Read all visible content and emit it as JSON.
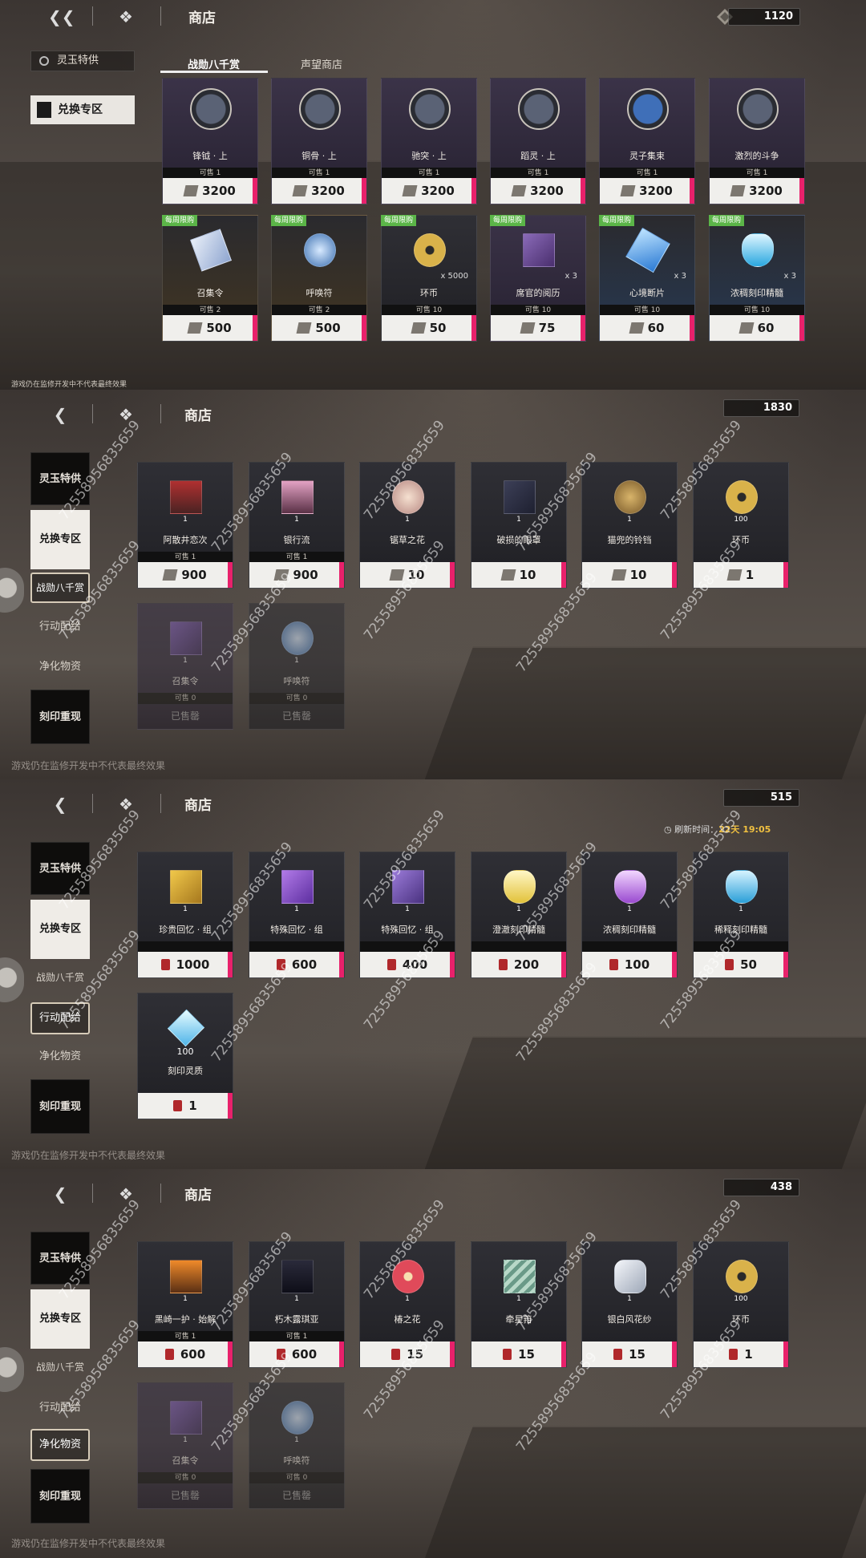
{
  "watermark": "72558956835659",
  "panel1": {
    "title": "商店",
    "currency": "1120",
    "side_items": [
      "灵玉特供",
      "兑换专区"
    ],
    "tabs": [
      "战勋八千赏",
      "声望商店"
    ],
    "footnote": "游戏仍在监修开发中不代表最终效果",
    "row1": [
      {
        "name": "锋钺 · 上",
        "limit": "可售 1",
        "price": "3200"
      },
      {
        "name": "铜骨 · 上",
        "limit": "可售 1",
        "price": "3200"
      },
      {
        "name": "驰突 · 上",
        "limit": "可售 1",
        "price": "3200"
      },
      {
        "name": "蹈灵 · 上",
        "limit": "可售 1",
        "price": "3200"
      },
      {
        "name": "灵子集束",
        "limit": "可售 1",
        "price": "3200"
      },
      {
        "name": "激烈的斗争",
        "limit": "可售 1",
        "price": "3200"
      }
    ],
    "row2": [
      {
        "badge": "每周限购",
        "name": "召集令",
        "limit": "可售 2",
        "price": "500",
        "x": ""
      },
      {
        "badge": "每周限购",
        "name": "呼唤符",
        "limit": "可售 2",
        "price": "500",
        "x": ""
      },
      {
        "badge": "每周限购",
        "name": "环币",
        "limit": "可售 10",
        "price": "50",
        "x": "x 5000"
      },
      {
        "badge": "每周限购",
        "name": "席官的阅历",
        "limit": "可售 10",
        "price": "75",
        "x": "x 3"
      },
      {
        "badge": "每周限购",
        "name": "心境断片",
        "limit": "可售 10",
        "price": "60",
        "x": "x 3"
      },
      {
        "badge": "每周限购",
        "name": "浓稠刻印精髓",
        "limit": "可售 10",
        "price": "60",
        "x": "x 3"
      }
    ]
  },
  "panel2": {
    "title": "商店",
    "currency": "1830",
    "side": [
      "灵玉特供",
      "兑换专区",
      "战勋八千赏",
      "行动配给",
      "净化物资",
      "刻印重现"
    ],
    "footnote": "游戏仍在监修开发中不代表最终效果",
    "row1": [
      {
        "name": "阿散井恋次",
        "qty": "1",
        "limit": "可售 1",
        "price": "900"
      },
      {
        "name": "银行流",
        "qty": "1",
        "limit": "可售 1",
        "price": "900"
      },
      {
        "name": "锯草之花",
        "qty": "1",
        "limit": "",
        "price": "10"
      },
      {
        "name": "破损的眼罩",
        "qty": "1",
        "limit": "",
        "price": "10"
      },
      {
        "name": "猫兜的铃铛",
        "qty": "1",
        "limit": "",
        "price": "10"
      },
      {
        "name": "环币",
        "qty": "100",
        "limit": "",
        "price": "1"
      }
    ],
    "row2": [
      {
        "name": "召集令",
        "qty": "1",
        "limit": "可售 0",
        "price": "已售罄"
      },
      {
        "name": "呼唤符",
        "qty": "1",
        "limit": "可售 0",
        "price": "已售罄"
      }
    ]
  },
  "panel3": {
    "title": "商店",
    "currency": "515",
    "timer_label": "刷新时间：",
    "timer_value": "22天 19:05",
    "footnote": "游戏仍在监修开发中不代表最终效果",
    "side": [
      "灵玉特供",
      "兑换专区",
      "战勋八千赏",
      "行动配给",
      "净化物资",
      "刻印重现"
    ],
    "row1": [
      {
        "name": "珍贵回忆 · 组",
        "qty": "1",
        "price": "1000"
      },
      {
        "name": "特殊回忆 · 组",
        "qty": "1",
        "price": "600"
      },
      {
        "name": "特殊回忆 · 组",
        "qty": "1",
        "price": "400"
      },
      {
        "name": "澄澈刻印精髓",
        "qty": "1",
        "price": "200"
      },
      {
        "name": "浓稠刻印精髓",
        "qty": "1",
        "price": "100"
      },
      {
        "name": "稀释刻印精髓",
        "qty": "1",
        "price": "50"
      }
    ],
    "row2": [
      {
        "name": "刻印灵质",
        "qty": "100",
        "price": "1"
      }
    ]
  },
  "panel4": {
    "title": "商店",
    "currency": "438",
    "footnote": "游戏仍在监修开发中不代表最终效果",
    "side": [
      "灵玉特供",
      "兑换专区",
      "战勋八千赏",
      "行动配给",
      "净化物资",
      "刻印重现"
    ],
    "row1": [
      {
        "name": "黑崎一护 · 始解",
        "qty": "1",
        "limit": "可售 1",
        "price": "600"
      },
      {
        "name": "朽木露琪亚",
        "qty": "1",
        "limit": "可售 1",
        "price": "600"
      },
      {
        "name": "椿之花",
        "qty": "1",
        "limit": "",
        "price": "15"
      },
      {
        "name": "牵星箝",
        "qty": "1",
        "limit": "",
        "price": "15"
      },
      {
        "name": "银白风花纱",
        "qty": "1",
        "limit": "",
        "price": "15"
      },
      {
        "name": "环币",
        "qty": "100",
        "limit": "",
        "price": "1"
      }
    ],
    "row2": [
      {
        "name": "召集令",
        "qty": "1",
        "limit": "可售 0",
        "price": "已售罄"
      },
      {
        "name": "呼唤符",
        "qty": "1",
        "limit": "可售 0",
        "price": "已售罄"
      }
    ]
  }
}
